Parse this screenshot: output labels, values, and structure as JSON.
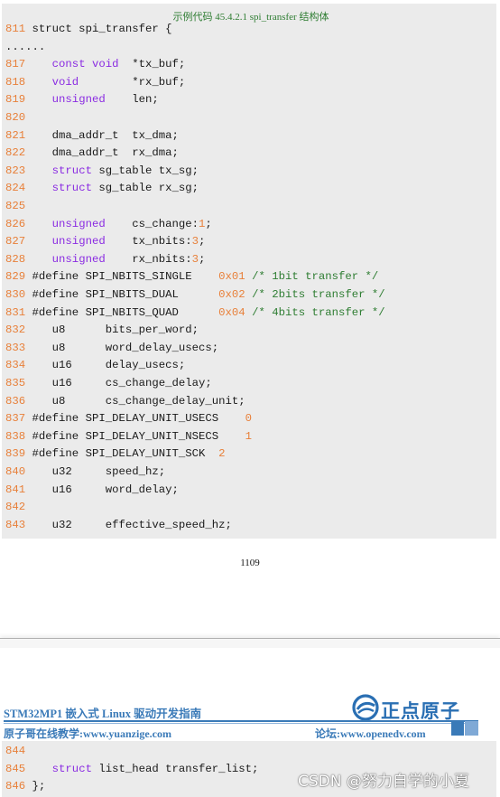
{
  "caption": "示例代码 45.4.2.1 spi_transfer 结构体",
  "code_lines": [
    [
      {
        "t": "811 ",
        "c": "ln"
      },
      {
        "t": "struct spi_transfer {",
        "c": "txt"
      }
    ],
    [
      {
        "t": "......",
        "c": "txt"
      }
    ],
    [
      {
        "t": "817 ",
        "c": "ln"
      },
      {
        "t": "   ",
        "c": "txt"
      },
      {
        "t": "const void",
        "c": "kw"
      },
      {
        "t": "  *tx_buf;",
        "c": "txt"
      }
    ],
    [
      {
        "t": "818 ",
        "c": "ln"
      },
      {
        "t": "   ",
        "c": "txt"
      },
      {
        "t": "void",
        "c": "kw"
      },
      {
        "t": "        *rx_buf;",
        "c": "txt"
      }
    ],
    [
      {
        "t": "819 ",
        "c": "ln"
      },
      {
        "t": "   ",
        "c": "txt"
      },
      {
        "t": "unsigned",
        "c": "kw"
      },
      {
        "t": "    len;",
        "c": "txt"
      }
    ],
    [
      {
        "t": "820",
        "c": "ln"
      }
    ],
    [
      {
        "t": "821 ",
        "c": "ln"
      },
      {
        "t": "   dma_addr_t  tx_dma;",
        "c": "txt"
      }
    ],
    [
      {
        "t": "822 ",
        "c": "ln"
      },
      {
        "t": "   dma_addr_t  rx_dma;",
        "c": "txt"
      }
    ],
    [
      {
        "t": "823 ",
        "c": "ln"
      },
      {
        "t": "   ",
        "c": "txt"
      },
      {
        "t": "struct",
        "c": "kw"
      },
      {
        "t": " sg_table tx_sg;",
        "c": "txt"
      }
    ],
    [
      {
        "t": "824 ",
        "c": "ln"
      },
      {
        "t": "   ",
        "c": "txt"
      },
      {
        "t": "struct",
        "c": "kw"
      },
      {
        "t": " sg_table rx_sg;",
        "c": "txt"
      }
    ],
    [
      {
        "t": "825",
        "c": "ln"
      }
    ],
    [
      {
        "t": "826 ",
        "c": "ln"
      },
      {
        "t": "   ",
        "c": "txt"
      },
      {
        "t": "unsigned",
        "c": "kw"
      },
      {
        "t": "    cs_change:",
        "c": "txt"
      },
      {
        "t": "1",
        "c": "num"
      },
      {
        "t": ";",
        "c": "txt"
      }
    ],
    [
      {
        "t": "827 ",
        "c": "ln"
      },
      {
        "t": "   ",
        "c": "txt"
      },
      {
        "t": "unsigned",
        "c": "kw"
      },
      {
        "t": "    tx_nbits:",
        "c": "txt"
      },
      {
        "t": "3",
        "c": "num"
      },
      {
        "t": ";",
        "c": "txt"
      }
    ],
    [
      {
        "t": "828 ",
        "c": "ln"
      },
      {
        "t": "   ",
        "c": "txt"
      },
      {
        "t": "unsigned",
        "c": "kw"
      },
      {
        "t": "    rx_nbits:",
        "c": "txt"
      },
      {
        "t": "3",
        "c": "num"
      },
      {
        "t": ";",
        "c": "txt"
      }
    ],
    [
      {
        "t": "829 ",
        "c": "ln"
      },
      {
        "t": "#define SPI_NBITS_SINGLE    ",
        "c": "txt"
      },
      {
        "t": "0x01",
        "c": "num"
      },
      {
        "t": " ",
        "c": "txt"
      },
      {
        "t": "/* 1bit transfer */",
        "c": "cmt"
      }
    ],
    [
      {
        "t": "830 ",
        "c": "ln"
      },
      {
        "t": "#define SPI_NBITS_DUAL      ",
        "c": "txt"
      },
      {
        "t": "0x02",
        "c": "num"
      },
      {
        "t": " ",
        "c": "txt"
      },
      {
        "t": "/* 2bits transfer */",
        "c": "cmt"
      }
    ],
    [
      {
        "t": "831 ",
        "c": "ln"
      },
      {
        "t": "#define SPI_NBITS_QUAD      ",
        "c": "txt"
      },
      {
        "t": "0x04",
        "c": "num"
      },
      {
        "t": " ",
        "c": "txt"
      },
      {
        "t": "/* 4bits transfer */",
        "c": "cmt"
      }
    ],
    [
      {
        "t": "832 ",
        "c": "ln"
      },
      {
        "t": "   u8      bits_per_word;",
        "c": "txt"
      }
    ],
    [
      {
        "t": "833 ",
        "c": "ln"
      },
      {
        "t": "   u8      word_delay_usecs;",
        "c": "txt"
      }
    ],
    [
      {
        "t": "834 ",
        "c": "ln"
      },
      {
        "t": "   u16     delay_usecs;",
        "c": "txt"
      }
    ],
    [
      {
        "t": "835 ",
        "c": "ln"
      },
      {
        "t": "   u16     cs_change_delay;",
        "c": "txt"
      }
    ],
    [
      {
        "t": "836 ",
        "c": "ln"
      },
      {
        "t": "   u8      cs_change_delay_unit;",
        "c": "txt"
      }
    ],
    [
      {
        "t": "837 ",
        "c": "ln"
      },
      {
        "t": "#define SPI_DELAY_UNIT_USECS    ",
        "c": "txt"
      },
      {
        "t": "0",
        "c": "num"
      }
    ],
    [
      {
        "t": "838 ",
        "c": "ln"
      },
      {
        "t": "#define SPI_DELAY_UNIT_NSECS    ",
        "c": "txt"
      },
      {
        "t": "1",
        "c": "num"
      }
    ],
    [
      {
        "t": "839 ",
        "c": "ln"
      },
      {
        "t": "#define SPI_DELAY_UNIT_SCK  ",
        "c": "txt"
      },
      {
        "t": "2",
        "c": "num"
      }
    ],
    [
      {
        "t": "840 ",
        "c": "ln"
      },
      {
        "t": "   u32     speed_hz;",
        "c": "txt"
      }
    ],
    [
      {
        "t": "841 ",
        "c": "ln"
      },
      {
        "t": "   u16     word_delay;",
        "c": "txt"
      }
    ],
    [
      {
        "t": "842",
        "c": "ln"
      }
    ],
    [
      {
        "t": "843 ",
        "c": "ln"
      },
      {
        "t": "   u32     effective_speed_hz;",
        "c": "txt"
      }
    ]
  ],
  "page_number": "1109",
  "header": {
    "book_title": "STM32MP1 嵌入式 Linux 驱动开发指南",
    "logo_text": "正点原子",
    "site_left": "原子哥在线教学:www.yuanzige.com",
    "site_right": "论坛:www.openedv.com"
  },
  "code_lines_2": [
    [
      {
        "t": "844",
        "c": "ln"
      }
    ],
    [
      {
        "t": "845 ",
        "c": "ln"
      },
      {
        "t": "   ",
        "c": "txt"
      },
      {
        "t": "struct",
        "c": "kw"
      },
      {
        "t": " list_head transfer_list;",
        "c": "txt"
      }
    ],
    [
      {
        "t": "846 ",
        "c": "ln"
      },
      {
        "t": "};",
        "c": "txt"
      }
    ]
  ],
  "watermark": "CSDN @努力自学的小夏",
  "colors": {
    "line_number": "#e8803a",
    "keyword": "#8a2be2",
    "comment": "#2e7d32",
    "header_blue": "#3a7ab8"
  }
}
